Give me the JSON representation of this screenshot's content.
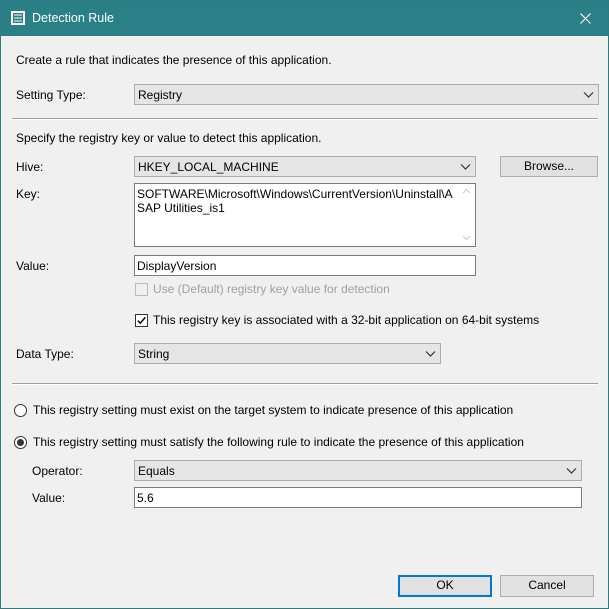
{
  "window": {
    "title": "Detection Rule",
    "close_glyph": "✕"
  },
  "intro": "Create a rule that indicates the presence of this application.",
  "setting_type": {
    "label": "Setting Type:",
    "value": "Registry"
  },
  "registry_instructions": "Specify the registry key or value to detect this application.",
  "hive": {
    "label": "Hive:",
    "value": "HKEY_LOCAL_MACHINE",
    "browse_label": "Browse..."
  },
  "key": {
    "label": "Key:",
    "value": "SOFTWARE\\Microsoft\\Windows\\CurrentVersion\\Uninstall\\ASAP Utilities_is1"
  },
  "value_field": {
    "label": "Value:",
    "value": "DisplayVersion"
  },
  "use_default": {
    "label": "Use (Default) registry key value for detection",
    "checked": false,
    "enabled": false
  },
  "is_32bit": {
    "label": "This registry key is associated with a 32-bit application on 64-bit systems",
    "checked": true
  },
  "data_type": {
    "label": "Data Type:",
    "value": "String"
  },
  "radio_exists": {
    "label": "This registry setting must exist on the target system to indicate presence of this application",
    "selected": false
  },
  "radio_rule": {
    "label": "This registry setting must satisfy the following rule to indicate the presence of this application",
    "selected": true
  },
  "operator": {
    "label": "Operator:",
    "value": "Equals"
  },
  "rule_value": {
    "label": "Value:",
    "value": "5.6"
  },
  "buttons": {
    "ok": "OK",
    "cancel": "Cancel"
  },
  "colors": {
    "titlebar": "#2a8086",
    "dialog_bg": "#f0f0f0",
    "focus_border": "#0078d7"
  }
}
